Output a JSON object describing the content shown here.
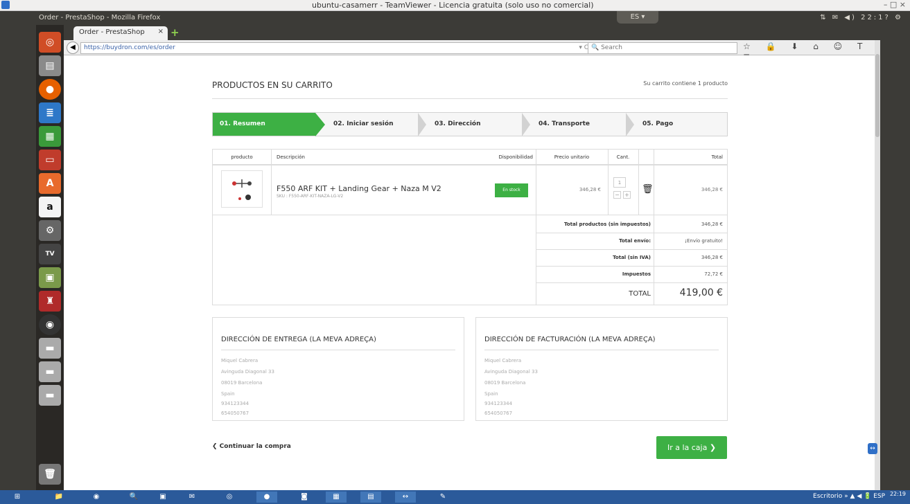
{
  "teamviewer": {
    "title": "ubuntu-casamerr - TeamViewer - Licencia gratuita (solo uso no comercial)",
    "controls": "– □ ×"
  },
  "topbar": {
    "window_title": "Order - PrestaShop - Mozilla Firefox",
    "clock": "22:1?",
    "lang": "ES ▾"
  },
  "browser": {
    "tab_label": "Order - PrestaShop",
    "tab_close": "×",
    "new_tab": "+",
    "back": "◀",
    "url": "https://buydron.com/es/order",
    "url_icons": "▾ C",
    "search_placeholder": "Search",
    "toolbar_icons": "☆ 🔒 ⬇ ⌂ ☺ T ≡"
  },
  "page": {
    "cart_title": "PRODUCTOS EN SU CARRITO",
    "cart_count": "Su carrito contiene 1 producto",
    "steps": [
      "01. Resumen",
      "02. Iniciar sesión",
      "03. Dirección",
      "04. Transporte",
      "05. Pago"
    ],
    "table": {
      "headers": [
        "producto",
        "Descripción",
        "Disponibilidad",
        "Precio unitario",
        "Cant.",
        "Total"
      ],
      "item": {
        "name": "F550 ARF KIT + Landing Gear + Naza M V2",
        "ref": "SKU : F550-ARF-KIT-NAZA-LG-V2",
        "availability": "En stock",
        "unit_price": "346,28 €",
        "qty": "1",
        "minus": "−",
        "plus": "+",
        "total": "346,28 €"
      },
      "summary": [
        {
          "label": "Total productos (sin impuestos)",
          "value": "346,28 €"
        },
        {
          "label": "Total envío:",
          "value": "¡Envío gratuito!"
        },
        {
          "label": "Total (sin IVA)",
          "value": "346,28 €"
        },
        {
          "label": "Impuestos",
          "value": "72,72 €"
        }
      ],
      "total_label": "TOTAL",
      "total_value": "419,00 €"
    },
    "delivery": {
      "title": "DIRECCIÓN DE ENTREGA (LA MEVA ADREÇA)",
      "lines": [
        "Miquel Cabrera",
        "Avinguda Diagonal 33",
        "08019 Barcelona",
        "Spain",
        "934123344",
        "654050767"
      ]
    },
    "billing": {
      "title": "DIRECCIÓN DE FACTURACIÓN (LA MEVA ADREÇA)",
      "lines": [
        "Miquel Cabrera",
        "Avinguda Diagonal 33",
        "08019 Barcelona",
        "Spain",
        "934123344",
        "654050767"
      ]
    },
    "continue": "❮ Continuar la compra",
    "checkout": "Ir a la caja ❯"
  },
  "taskbar": {
    "tray": "Escritorio »  ▲ ◀ 🔋 ESP",
    "clock": "22:19"
  }
}
